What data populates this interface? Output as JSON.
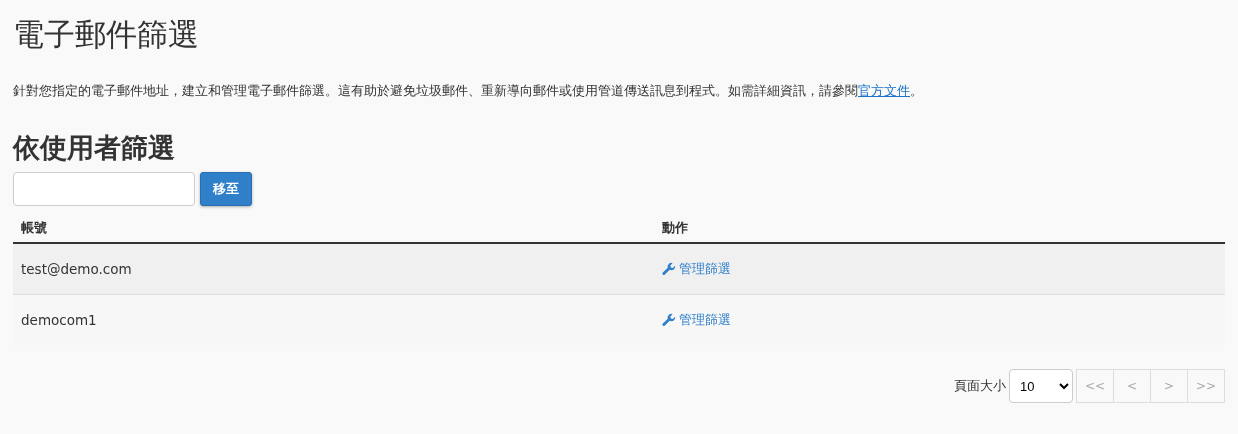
{
  "page_title": "電子郵件篩選",
  "description": {
    "text": "針對您指定的電子郵件地址，建立和管理電子郵件篩選。這有助於避免垃圾郵件、重新導向郵件或使用管道傳送訊息到程式。如需詳細資訊，請參閱",
    "link": "官方文件",
    "tail": "。"
  },
  "section_title": "依使用者篩選",
  "search": {
    "button": "移至"
  },
  "table": {
    "columns": [
      "帳號",
      "動作"
    ],
    "rows": [
      {
        "account": "test@demo.com",
        "action": "管理篩選"
      },
      {
        "account": "democom1",
        "action": "管理篩選"
      }
    ]
  },
  "pagination": {
    "label": "頁面大小",
    "page_size": "10",
    "buttons": [
      {
        "label": "<<",
        "disabled": true
      },
      {
        "label": "<",
        "disabled": true
      },
      {
        "label": ">",
        "disabled": true
      },
      {
        "label": ">>",
        "disabled": true
      }
    ]
  }
}
